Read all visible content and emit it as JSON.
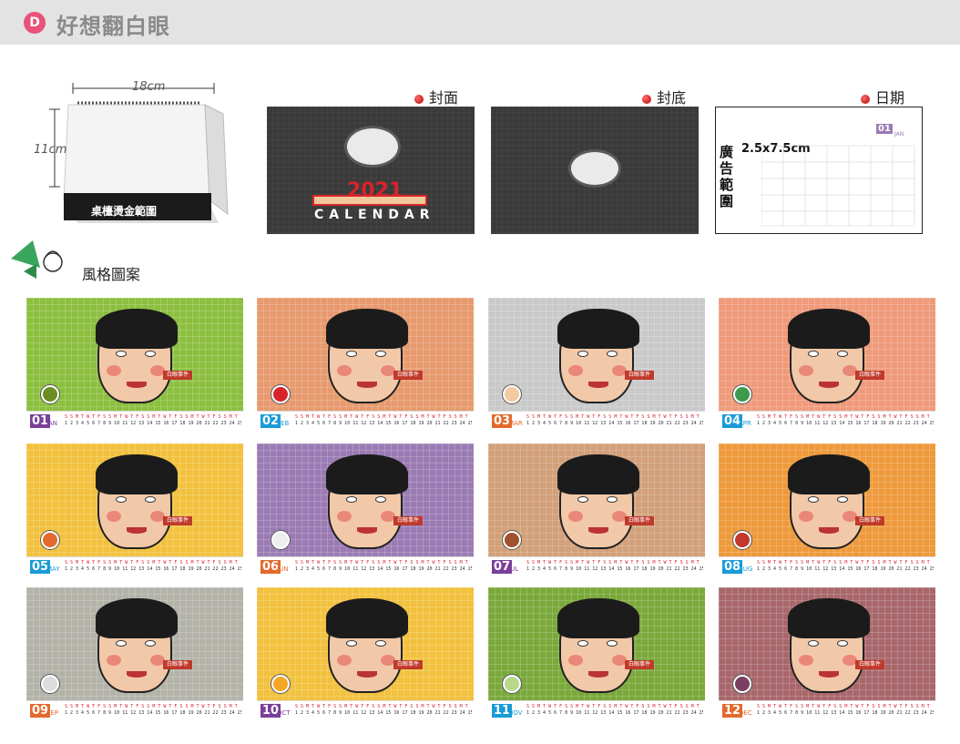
{
  "header": {
    "badge": "D",
    "title": "好想翻白眼"
  },
  "mockup": {
    "width_label": "18cm",
    "height_label": "11cm",
    "base_label": "桌檯燙金範圍"
  },
  "previews": {
    "cover_label": "封面",
    "back_label": "封底",
    "date_label": "日期",
    "cover_year": "2021",
    "cover_word": "CALENDAR",
    "ad_area": "廣告範圍",
    "ad_size": "2.5x7.5cm",
    "date_month_num": "01",
    "date_month_abbr": "JAN"
  },
  "style_section": {
    "title": "風格圖案"
  },
  "event_tag": "白眼事件",
  "days_row": "S S M T W T F S S M T W T F S S M T W T F S S M T W T F S S M T",
  "dates_row": "1 2 3 4 5 6 7 8 9 10 11 12 13 14 15 16 17 18 19 20 21 22 23 24 25 26 27 28 29 30 31",
  "cards": [
    {
      "num": "01",
      "abbr": "JAN",
      "bg": "#8cbf3f",
      "accent": "#7a3f98",
      "fruit": "#6b8e23"
    },
    {
      "num": "02",
      "abbr": "FEB",
      "bg": "#e79a6e",
      "accent": "#1a9bd7",
      "fruit": "#d8232a"
    },
    {
      "num": "03",
      "abbr": "MAR",
      "bg": "#c9c9c9",
      "accent": "#e26a2c",
      "fruit": "#f3c9a0"
    },
    {
      "num": "04",
      "abbr": "APR",
      "bg": "#ef9a7b",
      "accent": "#1a9bd7",
      "fruit": "#3b9b4b"
    },
    {
      "num": "05",
      "abbr": "MAY",
      "bg": "#f2c13e",
      "accent": "#1a9bd7",
      "fruit": "#e26a2c"
    },
    {
      "num": "06",
      "abbr": "JUN",
      "bg": "#9b7bb3",
      "accent": "#e26a2c",
      "fruit": "#eeeeee"
    },
    {
      "num": "07",
      "abbr": "JUL",
      "bg": "#d2a07a",
      "accent": "#7a3f98",
      "fruit": "#a0522d"
    },
    {
      "num": "08",
      "abbr": "AUG",
      "bg": "#ee9a3c",
      "accent": "#1a9bd7",
      "fruit": "#c0392b"
    },
    {
      "num": "09",
      "abbr": "SEP",
      "bg": "#b3b3aa",
      "accent": "#e26a2c",
      "fruit": "#dddddd"
    },
    {
      "num": "10",
      "abbr": "OCT",
      "bg": "#f2c13e",
      "accent": "#7a3f98",
      "fruit": "#f5a623"
    },
    {
      "num": "11",
      "abbr": "NOV",
      "bg": "#7aa83b",
      "accent": "#1a9bd7",
      "fruit": "#b8d98c"
    },
    {
      "num": "12",
      "abbr": "DEC",
      "bg": "#a8676b",
      "accent": "#e26a2c",
      "fruit": "#7a3f60"
    }
  ]
}
